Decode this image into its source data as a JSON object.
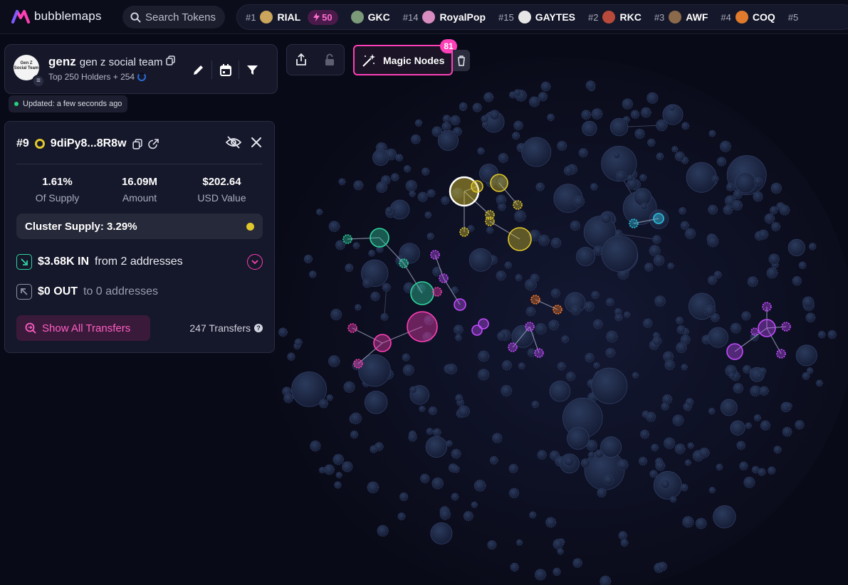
{
  "app": {
    "brand": "bubblemaps",
    "search_placeholder": "Search Tokens",
    "colors": {
      "accent": "#ff3fb7",
      "background": "#090a17",
      "gold": "#e0c72b",
      "green": "#2fd6a0",
      "purple": "#c34bff",
      "cyan": "#29c3e0",
      "orange": "#ff7b25"
    }
  },
  "ticker": [
    {
      "rank": "#1",
      "name": "RIAL",
      "boost": "50",
      "avatar_color": "#caa55b"
    },
    {
      "rank": "",
      "name": "GKC",
      "avatar_color": "#7a9a7a"
    },
    {
      "rank": "#14",
      "name": "RoyalPop",
      "avatar_color": "#d88cc0"
    },
    {
      "rank": "#15",
      "name": "GAYTES",
      "avatar_color": "#e6e6e6"
    },
    {
      "rank": "#2",
      "name": "RKC",
      "avatar_color": "#b84a3b"
    },
    {
      "rank": "#3",
      "name": "AWF",
      "avatar_color": "#8a6a4a"
    },
    {
      "rank": "#4",
      "name": "COQ",
      "avatar_color": "#e07a2c"
    },
    {
      "rank": "#5",
      "name": "",
      "avatar_color": "#444"
    }
  ],
  "token": {
    "symbol": "genz",
    "full_name": "gen z social team",
    "avatar_text": "Gen Z Social Team",
    "chain_icon": "solana-icon",
    "holders_label": "Top 250 Holders + 254",
    "updated": "Updated: a few seconds ago"
  },
  "detail": {
    "rank": "#9",
    "address": "9diPy8...8R8w",
    "stats": [
      {
        "value": "1.61%",
        "label": "Of Supply"
      },
      {
        "value": "16.09M",
        "label": "Amount"
      },
      {
        "value": "$202.64",
        "label": "USD Value"
      }
    ],
    "cluster_supply": "Cluster Supply: 3.29%",
    "inflow": {
      "amount": "$3.68K IN",
      "desc": "from 2 addresses"
    },
    "outflow": {
      "amount": "$0 OUT",
      "desc": "to 0 addresses"
    },
    "show_all": "Show All Transfers",
    "transfers": "247 Transfers"
  },
  "canvas": {
    "magic_nodes_label": "Magic Nodes",
    "magic_nodes_count": "81"
  }
}
